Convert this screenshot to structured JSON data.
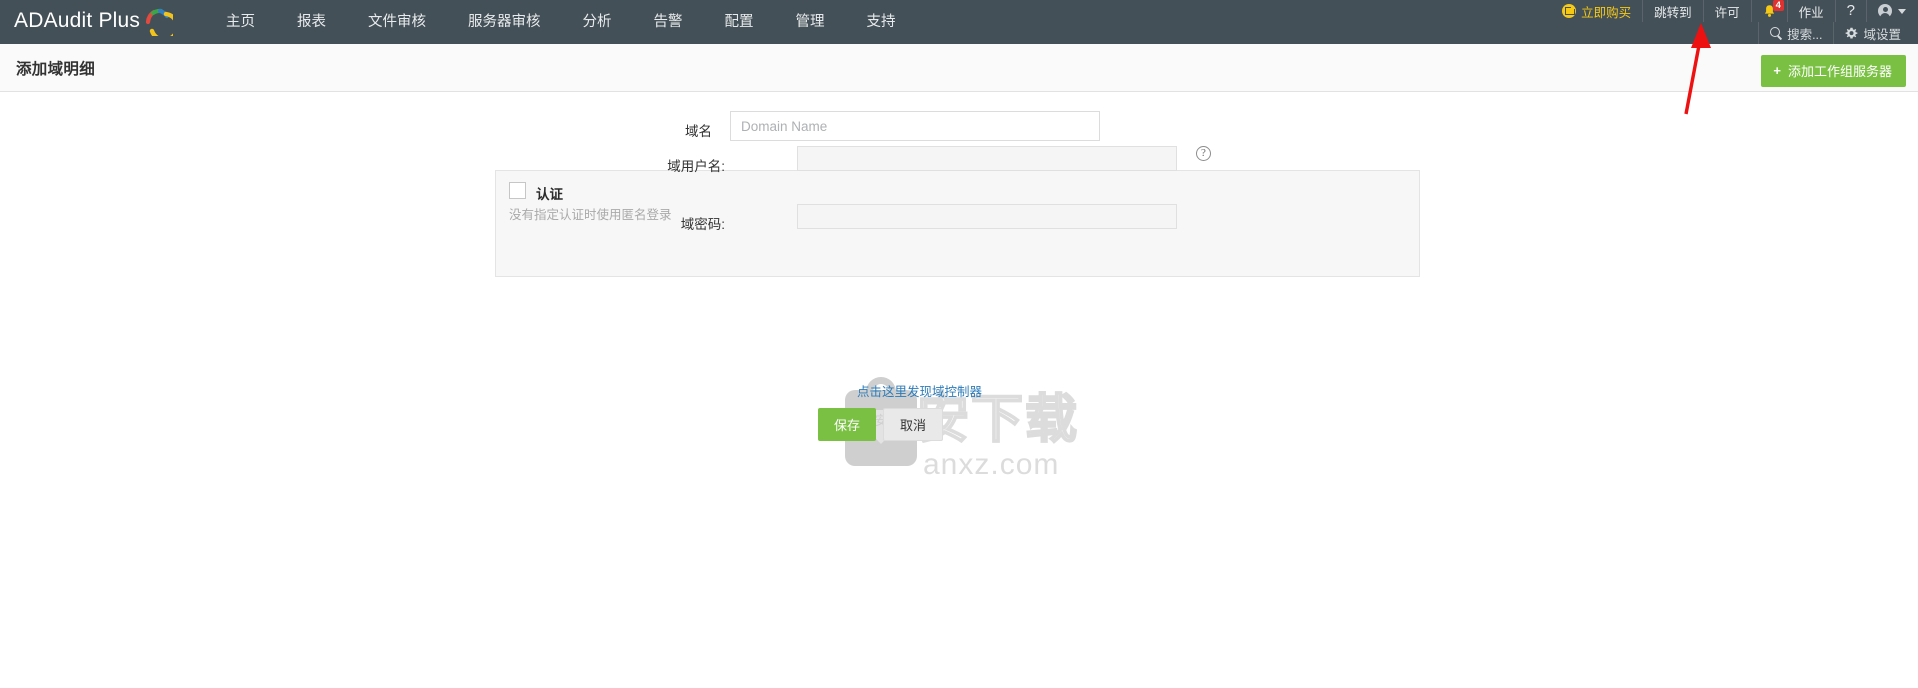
{
  "app": {
    "logo_text": "ADAudit Plus"
  },
  "header": {
    "nav": [
      {
        "label": "主页",
        "name": "nav-home"
      },
      {
        "label": "报表",
        "name": "nav-reports"
      },
      {
        "label": "文件审核",
        "name": "nav-file-audit"
      },
      {
        "label": "服务器审核",
        "name": "nav-server-audit"
      },
      {
        "label": "分析",
        "name": "nav-analytics"
      },
      {
        "label": "告警",
        "name": "nav-alerts"
      },
      {
        "label": "配置",
        "name": "nav-configuration"
      },
      {
        "label": "管理",
        "name": "nav-admin"
      },
      {
        "label": "支持",
        "name": "nav-support"
      }
    ],
    "utility": {
      "buy_now": "立即购买",
      "jump_to": "跳转到",
      "license": "许可",
      "notification_count": "4",
      "jobs": "作业",
      "help": "?"
    },
    "utility2": {
      "search": "搜索...",
      "domain_settings": "域设置"
    },
    "colors": {
      "bar_bg": "#445057",
      "accent_yellow": "#f6c915",
      "badge_red": "#e03131",
      "green": "#7ac143",
      "link_blue": "#2b7bb9"
    }
  },
  "subheader": {
    "page_title": "添加域明细",
    "add_workgroup_button": "添加工作组服务器",
    "plus": "+"
  },
  "form": {
    "domain_label": "域名",
    "domain_placeholder": "Domain Name",
    "domain_value": "",
    "auth_label": "认证",
    "auth_hint": "没有指定认证时使用匿名登录",
    "auth_checked": false,
    "username_label": "域用户名:",
    "username_value": "",
    "help_glyph": "?",
    "password_label": "域密码:",
    "password_value": "",
    "discover_link": "点击这里发现域控制器",
    "save_button": "保存",
    "cancel_button": "取消"
  },
  "watermark": {
    "main": "安下载",
    "sub": "anxz.com",
    "shield_char": "安"
  }
}
